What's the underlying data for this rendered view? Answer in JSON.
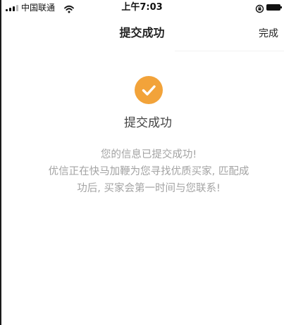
{
  "status_bar": {
    "carrier": "中国联通",
    "time": "上午7:03"
  },
  "nav": {
    "title": "提交成功",
    "done_label": "完成"
  },
  "success": {
    "title": "提交成功",
    "message_lines": [
      "您的信息已提交成功!",
      "优信正在快马加鞭为您寻找优质买家, 匹配成",
      "功后, 买家会第一时间与您联系!"
    ]
  },
  "colors": {
    "accent": "#f2a33a",
    "message_text": "#a3a3a3"
  },
  "icons": [
    "signal-icon",
    "wifi-icon",
    "orientation-lock-icon",
    "battery-icon",
    "checkmark-icon"
  ]
}
